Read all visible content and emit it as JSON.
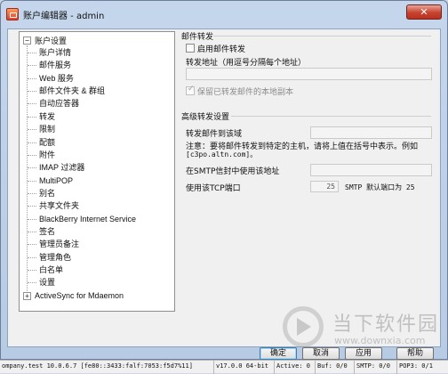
{
  "window": {
    "title": "账户编辑器 - admin",
    "close_label": "✕"
  },
  "tree": {
    "root_label": "账户设置",
    "root_expander": "−",
    "items": [
      {
        "label": "账户详情"
      },
      {
        "label": "邮件服务"
      },
      {
        "label": "Web 服务"
      },
      {
        "label": "邮件文件夹 & 群组"
      },
      {
        "label": "自动应答器"
      },
      {
        "label": "转发"
      },
      {
        "label": "限制"
      },
      {
        "label": "配额"
      },
      {
        "label": "附件"
      },
      {
        "label": "IMAP 过滤器"
      },
      {
        "label": "MultiPOP"
      },
      {
        "label": "别名"
      },
      {
        "label": "共享文件夹"
      },
      {
        "label": "BlackBerry Internet Service"
      },
      {
        "label": "签名"
      },
      {
        "label": "管理员备注"
      },
      {
        "label": "管理角色"
      },
      {
        "label": "白名单"
      },
      {
        "label": "设置"
      }
    ],
    "extra_expander": "+",
    "extra_label": "ActiveSync for Mdaemon"
  },
  "forwarding": {
    "section_title": "邮件转发",
    "enable_label": "启用邮件转发",
    "enable_checked": false,
    "address_label": "转发地址（用逗号分隔每个地址）",
    "address_value": "",
    "keep_copy_label": "保留已转发邮件的本地副本",
    "keep_copy_checked": true
  },
  "advanced": {
    "section_title": "高级转发设置",
    "domain_label": "转发邮件到该域",
    "domain_value": "",
    "note_line1": "注意：要将邮件转发到特定的主机，请将上值在括号中表示。例如",
    "note_line2": "[c3po.altn.com]。",
    "smtp_envelope_label": "在SMTP信封中使用该地址",
    "smtp_envelope_value": "",
    "tcp_port_label": "使用该TCP端口",
    "tcp_port_value": "25",
    "smtp_default_label": "SMTP 默认端口为 25"
  },
  "buttons": {
    "ok": "确定",
    "cancel": "取消",
    "apply": "应用",
    "help": "帮助"
  },
  "statusbar": {
    "host": "ompany.test 10.0.6.7 [fe80::3433:falf:7053:f5d7%11]",
    "version": "v17.0.0 64-bit",
    "active": "Active: 0",
    "buf": "Buf: 0/0",
    "smtp": "SMTP: 0/0",
    "pop3": "POP3: 0/1"
  },
  "watermark": {
    "brand": "当下软件园",
    "url": "www.downxia.com"
  }
}
